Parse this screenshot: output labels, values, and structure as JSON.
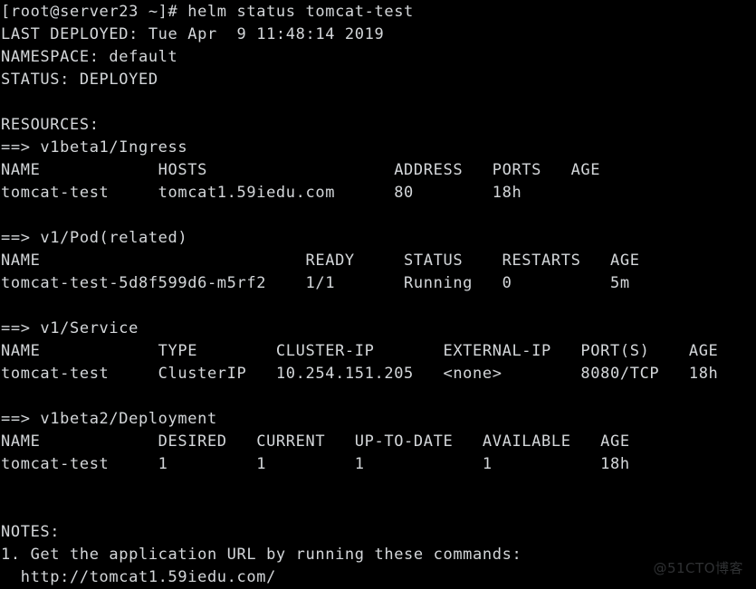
{
  "terminal": {
    "title": "helm status tomcat-test",
    "background_color": "#000000",
    "text_color": "#d4d7da",
    "prompt": "[root@server23 ~]#",
    "command": "helm status tomcat-test",
    "prompt_line": "[root@server23 ~]# helm status tomcat-test"
  },
  "release": {
    "last_deployed_label": "LAST DEPLOYED:",
    "last_deployed_value": "Tue Apr  9 11:48:14 2019",
    "last_deployed_line": "LAST DEPLOYED: Tue Apr  9 11:48:14 2019",
    "namespace_label": "NAMESPACE:",
    "namespace_value": "default",
    "namespace_line": "NAMESPACE: default",
    "status_label": "STATUS:",
    "status_value": "DEPLOYED",
    "status_line": "STATUS: DEPLOYED"
  },
  "resources": {
    "heading": "RESOURCES:",
    "sections": [
      {
        "arrow": "==>",
        "kind": "v1beta1/Ingress",
        "kind_line": "==> v1beta1/Ingress",
        "headers": [
          "NAME",
          "HOSTS",
          "ADDRESS",
          "PORTS",
          "AGE"
        ],
        "header_line": "NAME            HOSTS                   ADDRESS   PORTS   AGE",
        "rows": [
          {
            "cells": [
              "tomcat-test",
              "tomcat1.59iedu.com",
              "80",
              "18h",
              ""
            ],
            "row_line": "tomcat-test     tomcat1.59iedu.com      80        18h"
          }
        ]
      },
      {
        "arrow": "==>",
        "kind": "v1/Pod(related)",
        "kind_line": "==> v1/Pod(related)",
        "headers": [
          "NAME",
          "READY",
          "STATUS",
          "RESTARTS",
          "AGE"
        ],
        "header_line": "NAME                           READY     STATUS    RESTARTS   AGE",
        "rows": [
          {
            "cells": [
              "tomcat-test-5d8f599d6-m5rf2",
              "1/1",
              "Running",
              "0",
              "5m"
            ],
            "row_line": "tomcat-test-5d8f599d6-m5rf2    1/1       Running   0          5m"
          }
        ]
      },
      {
        "arrow": "==>",
        "kind": "v1/Service",
        "kind_line": "==> v1/Service",
        "headers": [
          "NAME",
          "TYPE",
          "CLUSTER-IP",
          "EXTERNAL-IP",
          "PORT(S)",
          "AGE"
        ],
        "header_line": "NAME            TYPE        CLUSTER-IP       EXTERNAL-IP   PORT(S)    AGE",
        "rows": [
          {
            "cells": [
              "tomcat-test",
              "ClusterIP",
              "10.254.151.205",
              "<none>",
              "8080/TCP",
              "18h"
            ],
            "row_line": "tomcat-test     ClusterIP   10.254.151.205   <none>        8080/TCP   18h"
          }
        ]
      },
      {
        "arrow": "==>",
        "kind": "v1beta2/Deployment",
        "kind_line": "==> v1beta2/Deployment",
        "headers": [
          "NAME",
          "DESIRED",
          "CURRENT",
          "UP-TO-DATE",
          "AVAILABLE",
          "AGE"
        ],
        "header_line": "NAME            DESIRED   CURRENT   UP-TO-DATE   AVAILABLE   AGE",
        "rows": [
          {
            "cells": [
              "tomcat-test",
              "1",
              "1",
              "1",
              "1",
              "18h"
            ],
            "row_line": "tomcat-test     1         1         1            1           18h"
          }
        ]
      }
    ]
  },
  "notes": {
    "heading": "NOTES:",
    "items": [
      "1. Get the application URL by running these commands:",
      "  http://tomcat1.59iedu.com/"
    ]
  },
  "watermark": {
    "text": "@51CTO博客",
    "color": "#2f3133"
  }
}
